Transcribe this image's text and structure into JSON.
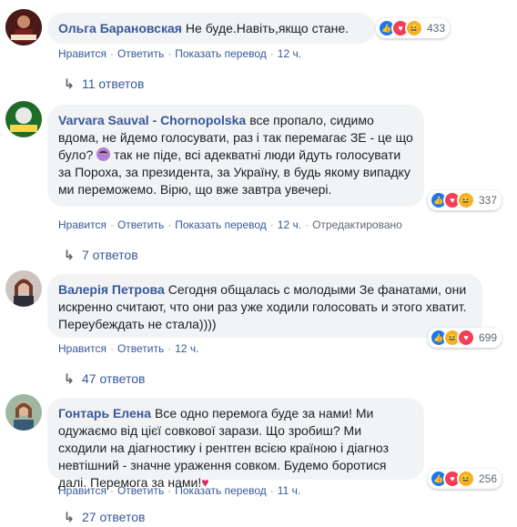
{
  "icons": {
    "like": "like-icon",
    "love": "love-icon",
    "haha": "haha-icon",
    "arrow": "reply-arrow-icon"
  },
  "colors": {
    "link": "#385898",
    "bubble": "#f2f3f5",
    "meta": "#606770",
    "like": "#1877f2",
    "love": "#f33e58",
    "haha": "#f7b125"
  },
  "comments": [
    {
      "author": "Ольга Барановская",
      "text": "Не буде.Навіть,якщо стане.",
      "reaction_count": "433",
      "actions": {
        "like": "Нравится",
        "reply": "Ответить",
        "translate": "Показать перевод",
        "time": "12 ч."
      },
      "replies": "11 ответов"
    },
    {
      "author": "Varvara Sauval - Chornopolska",
      "text_part1": "все пропало, сидимо вдома, не йдемо голосувати, раз і так перемагає ЗЕ - це що було?",
      "text_part2": "так не піде, всі адекватні люди йдуть голосувати за Пороха, за президента, за Україну, в будь якому випадку ми переможемо. Вірю, що вже завтра увечері.",
      "reaction_count": "337",
      "actions": {
        "like": "Нравится",
        "reply": "Ответить",
        "translate": "Показать перевод",
        "time": "12 ч.",
        "edited": "Отредактировано"
      },
      "replies": "7 ответов"
    },
    {
      "author": "Валерія Петрова",
      "text": "Сегодня общалась с молодыми Зе фанатами, они искренно считают, что они раз уже ходили голосовать и этого хватит. Переубеждать не стала))))",
      "reaction_count": "699",
      "actions": {
        "like": "Нравится",
        "reply": "Ответить",
        "time": "12 ч."
      },
      "replies": "47 ответов"
    },
    {
      "author": "Гонтарь Елена",
      "text": "Все одно перемога буде за нами! Ми одужаємо від цієї совкової зарази. Що зробиш? Ми сходили на діагностику і рентген всією країною і діагноз невтішний - значне ураження совком. Будемо боротися далі. Перемога за нами!",
      "reaction_count": "256",
      "actions": {
        "like": "Нравится",
        "reply": "Ответить",
        "translate": "Показать перевод",
        "time": "11 ч."
      },
      "replies": "27 ответов"
    }
  ]
}
